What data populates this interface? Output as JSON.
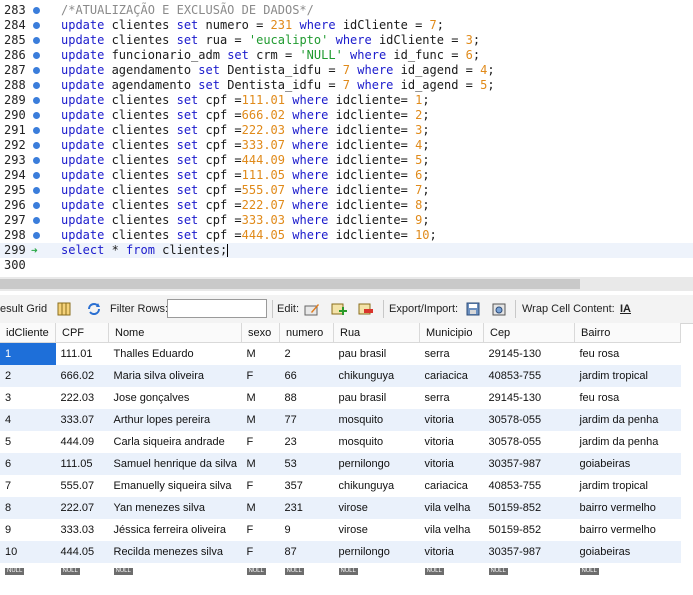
{
  "editor": {
    "lines": [
      {
        "n": "283",
        "marker": "bp",
        "tokens": [
          [
            "cm",
            "/*ATUALIZAÇÃO E EXCLUSÃO DE DADOS*/"
          ]
        ]
      },
      {
        "n": "284",
        "marker": "bp",
        "tokens": [
          [
            "kw",
            "update"
          ],
          [
            "tx",
            " clientes "
          ],
          [
            "kw",
            "set"
          ],
          [
            "tx",
            " numero = "
          ],
          [
            "num",
            "231"
          ],
          [
            "tx",
            " "
          ],
          [
            "kw",
            "where"
          ],
          [
            "tx",
            " idCliente = "
          ],
          [
            "num",
            "7"
          ],
          [
            "tx",
            ";"
          ]
        ]
      },
      {
        "n": "285",
        "marker": "bp",
        "tokens": [
          [
            "kw",
            "update"
          ],
          [
            "tx",
            " clientes "
          ],
          [
            "kw",
            "set"
          ],
          [
            "tx",
            " rua = "
          ],
          [
            "str",
            "'eucalipto'"
          ],
          [
            "tx",
            " "
          ],
          [
            "kw",
            "where"
          ],
          [
            "tx",
            " idCliente = "
          ],
          [
            "num",
            "3"
          ],
          [
            "tx",
            ";"
          ]
        ]
      },
      {
        "n": "286",
        "marker": "bp",
        "tokens": [
          [
            "kw",
            "update"
          ],
          [
            "tx",
            " funcionario_adm "
          ],
          [
            "kw",
            "set"
          ],
          [
            "tx",
            " crm = "
          ],
          [
            "str",
            "'NULL'"
          ],
          [
            "tx",
            " "
          ],
          [
            "kw",
            "where"
          ],
          [
            "tx",
            " id_func = "
          ],
          [
            "num",
            "6"
          ],
          [
            "tx",
            ";"
          ]
        ]
      },
      {
        "n": "287",
        "marker": "bp",
        "tokens": [
          [
            "kw",
            "update"
          ],
          [
            "tx",
            " agendamento "
          ],
          [
            "kw",
            "set"
          ],
          [
            "tx",
            " Dentista_idfu = "
          ],
          [
            "num",
            "7"
          ],
          [
            "tx",
            " "
          ],
          [
            "kw",
            "where"
          ],
          [
            "tx",
            " id_agend = "
          ],
          [
            "num",
            "4"
          ],
          [
            "tx",
            ";"
          ]
        ]
      },
      {
        "n": "288",
        "marker": "bp",
        "tokens": [
          [
            "kw",
            "update"
          ],
          [
            "tx",
            " agendamento "
          ],
          [
            "kw",
            "set"
          ],
          [
            "tx",
            " Dentista_idfu = "
          ],
          [
            "num",
            "7"
          ],
          [
            "tx",
            " "
          ],
          [
            "kw",
            "where"
          ],
          [
            "tx",
            " id_agend = "
          ],
          [
            "num",
            "5"
          ],
          [
            "tx",
            ";"
          ]
        ]
      },
      {
        "n": "289",
        "marker": "bp",
        "tokens": [
          [
            "kw",
            "update"
          ],
          [
            "tx",
            " clientes "
          ],
          [
            "kw",
            "set"
          ],
          [
            "tx",
            " cpf ="
          ],
          [
            "num",
            "111.01"
          ],
          [
            "tx",
            " "
          ],
          [
            "kw",
            "where"
          ],
          [
            "tx",
            " idcliente= "
          ],
          [
            "num",
            "1"
          ],
          [
            "tx",
            ";"
          ]
        ]
      },
      {
        "n": "290",
        "marker": "bp",
        "tokens": [
          [
            "kw",
            "update"
          ],
          [
            "tx",
            " clientes "
          ],
          [
            "kw",
            "set"
          ],
          [
            "tx",
            " cpf ="
          ],
          [
            "num",
            "666.02"
          ],
          [
            "tx",
            " "
          ],
          [
            "kw",
            "where"
          ],
          [
            "tx",
            " idcliente= "
          ],
          [
            "num",
            "2"
          ],
          [
            "tx",
            ";"
          ]
        ]
      },
      {
        "n": "291",
        "marker": "bp",
        "tokens": [
          [
            "kw",
            "update"
          ],
          [
            "tx",
            " clientes "
          ],
          [
            "kw",
            "set"
          ],
          [
            "tx",
            " cpf ="
          ],
          [
            "num",
            "222.03"
          ],
          [
            "tx",
            " "
          ],
          [
            "kw",
            "where"
          ],
          [
            "tx",
            " idcliente= "
          ],
          [
            "num",
            "3"
          ],
          [
            "tx",
            ";"
          ]
        ]
      },
      {
        "n": "292",
        "marker": "bp",
        "tokens": [
          [
            "kw",
            "update"
          ],
          [
            "tx",
            " clientes "
          ],
          [
            "kw",
            "set"
          ],
          [
            "tx",
            " cpf ="
          ],
          [
            "num",
            "333.07"
          ],
          [
            "tx",
            " "
          ],
          [
            "kw",
            "where"
          ],
          [
            "tx",
            " idcliente= "
          ],
          [
            "num",
            "4"
          ],
          [
            "tx",
            ";"
          ]
        ]
      },
      {
        "n": "293",
        "marker": "bp",
        "tokens": [
          [
            "kw",
            "update"
          ],
          [
            "tx",
            " clientes "
          ],
          [
            "kw",
            "set"
          ],
          [
            "tx",
            " cpf ="
          ],
          [
            "num",
            "444.09"
          ],
          [
            "tx",
            " "
          ],
          [
            "kw",
            "where"
          ],
          [
            "tx",
            " idcliente= "
          ],
          [
            "num",
            "5"
          ],
          [
            "tx",
            ";"
          ]
        ]
      },
      {
        "n": "294",
        "marker": "bp",
        "tokens": [
          [
            "kw",
            "update"
          ],
          [
            "tx",
            " clientes "
          ],
          [
            "kw",
            "set"
          ],
          [
            "tx",
            " cpf ="
          ],
          [
            "num",
            "111.05"
          ],
          [
            "tx",
            " "
          ],
          [
            "kw",
            "where"
          ],
          [
            "tx",
            " idcliente= "
          ],
          [
            "num",
            "6"
          ],
          [
            "tx",
            ";"
          ]
        ]
      },
      {
        "n": "295",
        "marker": "bp",
        "tokens": [
          [
            "kw",
            "update"
          ],
          [
            "tx",
            " clientes "
          ],
          [
            "kw",
            "set"
          ],
          [
            "tx",
            " cpf ="
          ],
          [
            "num",
            "555.07"
          ],
          [
            "tx",
            " "
          ],
          [
            "kw",
            "where"
          ],
          [
            "tx",
            " idcliente= "
          ],
          [
            "num",
            "7"
          ],
          [
            "tx",
            ";"
          ]
        ]
      },
      {
        "n": "296",
        "marker": "bp",
        "tokens": [
          [
            "kw",
            "update"
          ],
          [
            "tx",
            " clientes "
          ],
          [
            "kw",
            "set"
          ],
          [
            "tx",
            " cpf ="
          ],
          [
            "num",
            "222.07"
          ],
          [
            "tx",
            " "
          ],
          [
            "kw",
            "where"
          ],
          [
            "tx",
            " idcliente= "
          ],
          [
            "num",
            "8"
          ],
          [
            "tx",
            ";"
          ]
        ]
      },
      {
        "n": "297",
        "marker": "bp",
        "tokens": [
          [
            "kw",
            "update"
          ],
          [
            "tx",
            " clientes "
          ],
          [
            "kw",
            "set"
          ],
          [
            "tx",
            " cpf ="
          ],
          [
            "num",
            "333.03"
          ],
          [
            "tx",
            " "
          ],
          [
            "kw",
            "where"
          ],
          [
            "tx",
            " idcliente= "
          ],
          [
            "num",
            "9"
          ],
          [
            "tx",
            ";"
          ]
        ]
      },
      {
        "n": "298",
        "marker": "bp",
        "tokens": [
          [
            "kw",
            "update"
          ],
          [
            "tx",
            " clientes "
          ],
          [
            "kw",
            "set"
          ],
          [
            "tx",
            " cpf ="
          ],
          [
            "num",
            "444.05"
          ],
          [
            "tx",
            " "
          ],
          [
            "kw",
            "where"
          ],
          [
            "tx",
            " idcliente= "
          ],
          [
            "num",
            "10"
          ],
          [
            "tx",
            ";"
          ]
        ]
      },
      {
        "n": "299",
        "marker": "exec",
        "tokens": [
          [
            "kw",
            "select"
          ],
          [
            "tx",
            " * "
          ],
          [
            "kw",
            "from"
          ],
          [
            "tx",
            " clientes;"
          ]
        ]
      },
      {
        "n": "300",
        "marker": "",
        "tokens": []
      }
    ]
  },
  "toolbar": {
    "result_grid_label": "esult Grid",
    "filter_rows_label": "Filter Rows:",
    "edit_label": "Edit:",
    "export_import_label": "Export/Import:",
    "wrap_label": "Wrap Cell Content:",
    "wrap_icon": "IA"
  },
  "grid": {
    "columns": [
      "idCliente",
      "CPF",
      "Nome",
      "sexo",
      "numero",
      "Rua",
      "Municipio",
      "Cep",
      "Bairro"
    ],
    "rows": [
      [
        "1",
        "111.01",
        "Thalles Eduardo",
        "M",
        "2",
        "pau brasil",
        "serra",
        "29145-130",
        "feu rosa"
      ],
      [
        "2",
        "666.02",
        "Maria silva oliveira",
        "F",
        "66",
        "chikunguya",
        "cariacica",
        "40853-755",
        "jardim tropical"
      ],
      [
        "3",
        "222.03",
        "Jose gonçalves",
        "M",
        "88",
        "pau brasil",
        "serra",
        "29145-130",
        "feu rosa"
      ],
      [
        "4",
        "333.07",
        "Arthur lopes pereira",
        "M",
        "77",
        "mosquito",
        "vitoria",
        "30578-055",
        "jardim da penha"
      ],
      [
        "5",
        "444.09",
        "Carla siqueira andrade",
        "F",
        "23",
        "mosquito",
        "vitoria",
        "30578-055",
        "jardim da penha"
      ],
      [
        "6",
        "111.05",
        "Samuel henrique da silva",
        "M",
        "53",
        "pernilongo",
        "vitoria",
        "30357-987",
        "goiabeiras"
      ],
      [
        "7",
        "555.07",
        "Emanuelly siqueira silva",
        "F",
        "357",
        "chikunguya",
        "cariacica",
        "40853-755",
        "jardim tropical"
      ],
      [
        "8",
        "222.07",
        "Yan menezes silva",
        "M",
        "231",
        "virose",
        "vila velha",
        "50159-852",
        "bairro vermelho"
      ],
      [
        "9",
        "333.03",
        "Jéssica ferreira oliveira",
        "F",
        "9",
        "virose",
        "vila velha",
        "50159-852",
        "bairro vermelho"
      ],
      [
        "10",
        "444.05",
        "Recilda menezes silva",
        "F",
        "87",
        "pernilongo",
        "vitoria",
        "30357-987",
        "goiabeiras"
      ]
    ],
    "null_label": "NULL"
  }
}
